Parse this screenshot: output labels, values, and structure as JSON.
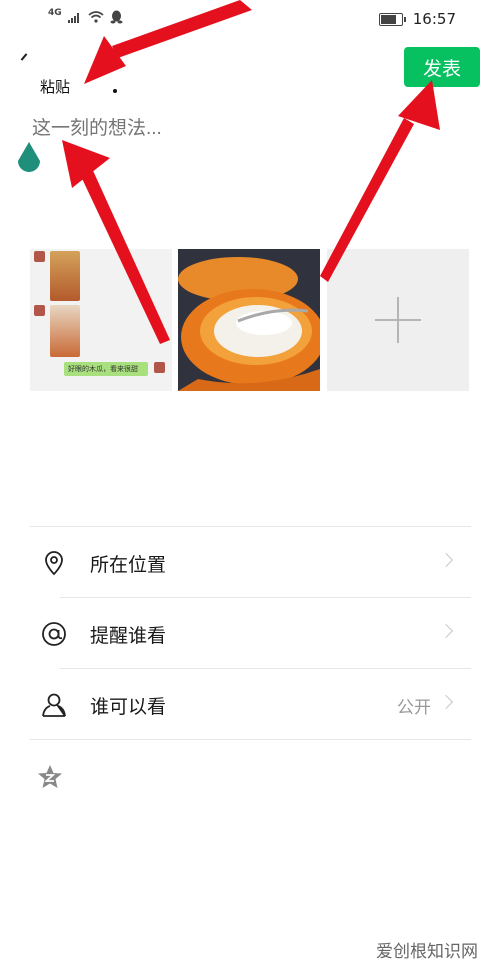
{
  "status_bar": {
    "network": "4G",
    "time": "16:57",
    "battery_level": 0.7
  },
  "header": {
    "paste_label": "粘贴",
    "publish_label": "发表"
  },
  "compose": {
    "placeholder": "这一刻的想法..."
  },
  "photos": [
    {
      "name": "chat-screenshot",
      "caption": "好眼的木瓜，看来很甜"
    },
    {
      "name": "papaya-with-milk"
    },
    {
      "name": "add-photo"
    }
  ],
  "options": [
    {
      "label": "所在位置",
      "value": "",
      "icon": "location-pin-icon"
    },
    {
      "label": "提醒谁看",
      "value": "",
      "icon": "at-sign-icon"
    },
    {
      "label": "谁可以看",
      "value": "公开",
      "icon": "person-icon"
    }
  ],
  "extra_icon": "qzone-star-icon",
  "watermark": "爱创根知识网",
  "colors": {
    "accent": "#07c160",
    "annotation_arrow": "#e5101d",
    "drop": "#1f8f7b"
  }
}
